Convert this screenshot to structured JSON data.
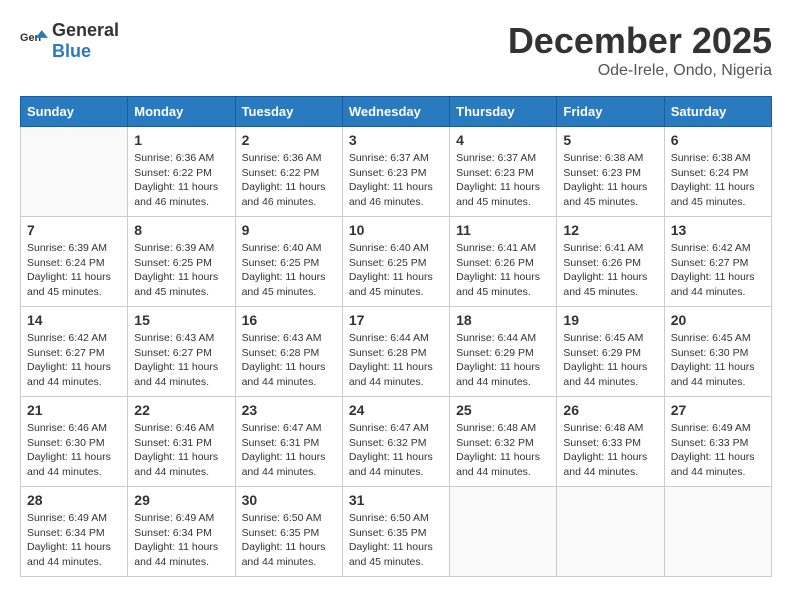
{
  "logo": {
    "general": "General",
    "blue": "Blue"
  },
  "title": {
    "month_year": "December 2025",
    "location": "Ode-Irele, Ondo, Nigeria"
  },
  "headers": [
    "Sunday",
    "Monday",
    "Tuesday",
    "Wednesday",
    "Thursday",
    "Friday",
    "Saturday"
  ],
  "weeks": [
    [
      {
        "day": "",
        "info": ""
      },
      {
        "day": "1",
        "info": "Sunrise: 6:36 AM\nSunset: 6:22 PM\nDaylight: 11 hours and 46 minutes."
      },
      {
        "day": "2",
        "info": "Sunrise: 6:36 AM\nSunset: 6:22 PM\nDaylight: 11 hours and 46 minutes."
      },
      {
        "day": "3",
        "info": "Sunrise: 6:37 AM\nSunset: 6:23 PM\nDaylight: 11 hours and 46 minutes."
      },
      {
        "day": "4",
        "info": "Sunrise: 6:37 AM\nSunset: 6:23 PM\nDaylight: 11 hours and 45 minutes."
      },
      {
        "day": "5",
        "info": "Sunrise: 6:38 AM\nSunset: 6:23 PM\nDaylight: 11 hours and 45 minutes."
      },
      {
        "day": "6",
        "info": "Sunrise: 6:38 AM\nSunset: 6:24 PM\nDaylight: 11 hours and 45 minutes."
      }
    ],
    [
      {
        "day": "7",
        "info": "Sunrise: 6:39 AM\nSunset: 6:24 PM\nDaylight: 11 hours and 45 minutes."
      },
      {
        "day": "8",
        "info": "Sunrise: 6:39 AM\nSunset: 6:25 PM\nDaylight: 11 hours and 45 minutes."
      },
      {
        "day": "9",
        "info": "Sunrise: 6:40 AM\nSunset: 6:25 PM\nDaylight: 11 hours and 45 minutes."
      },
      {
        "day": "10",
        "info": "Sunrise: 6:40 AM\nSunset: 6:25 PM\nDaylight: 11 hours and 45 minutes."
      },
      {
        "day": "11",
        "info": "Sunrise: 6:41 AM\nSunset: 6:26 PM\nDaylight: 11 hours and 45 minutes."
      },
      {
        "day": "12",
        "info": "Sunrise: 6:41 AM\nSunset: 6:26 PM\nDaylight: 11 hours and 45 minutes."
      },
      {
        "day": "13",
        "info": "Sunrise: 6:42 AM\nSunset: 6:27 PM\nDaylight: 11 hours and 44 minutes."
      }
    ],
    [
      {
        "day": "14",
        "info": "Sunrise: 6:42 AM\nSunset: 6:27 PM\nDaylight: 11 hours and 44 minutes."
      },
      {
        "day": "15",
        "info": "Sunrise: 6:43 AM\nSunset: 6:27 PM\nDaylight: 11 hours and 44 minutes."
      },
      {
        "day": "16",
        "info": "Sunrise: 6:43 AM\nSunset: 6:28 PM\nDaylight: 11 hours and 44 minutes."
      },
      {
        "day": "17",
        "info": "Sunrise: 6:44 AM\nSunset: 6:28 PM\nDaylight: 11 hours and 44 minutes."
      },
      {
        "day": "18",
        "info": "Sunrise: 6:44 AM\nSunset: 6:29 PM\nDaylight: 11 hours and 44 minutes."
      },
      {
        "day": "19",
        "info": "Sunrise: 6:45 AM\nSunset: 6:29 PM\nDaylight: 11 hours and 44 minutes."
      },
      {
        "day": "20",
        "info": "Sunrise: 6:45 AM\nSunset: 6:30 PM\nDaylight: 11 hours and 44 minutes."
      }
    ],
    [
      {
        "day": "21",
        "info": "Sunrise: 6:46 AM\nSunset: 6:30 PM\nDaylight: 11 hours and 44 minutes."
      },
      {
        "day": "22",
        "info": "Sunrise: 6:46 AM\nSunset: 6:31 PM\nDaylight: 11 hours and 44 minutes."
      },
      {
        "day": "23",
        "info": "Sunrise: 6:47 AM\nSunset: 6:31 PM\nDaylight: 11 hours and 44 minutes."
      },
      {
        "day": "24",
        "info": "Sunrise: 6:47 AM\nSunset: 6:32 PM\nDaylight: 11 hours and 44 minutes."
      },
      {
        "day": "25",
        "info": "Sunrise: 6:48 AM\nSunset: 6:32 PM\nDaylight: 11 hours and 44 minutes."
      },
      {
        "day": "26",
        "info": "Sunrise: 6:48 AM\nSunset: 6:33 PM\nDaylight: 11 hours and 44 minutes."
      },
      {
        "day": "27",
        "info": "Sunrise: 6:49 AM\nSunset: 6:33 PM\nDaylight: 11 hours and 44 minutes."
      }
    ],
    [
      {
        "day": "28",
        "info": "Sunrise: 6:49 AM\nSunset: 6:34 PM\nDaylight: 11 hours and 44 minutes."
      },
      {
        "day": "29",
        "info": "Sunrise: 6:49 AM\nSunset: 6:34 PM\nDaylight: 11 hours and 44 minutes."
      },
      {
        "day": "30",
        "info": "Sunrise: 6:50 AM\nSunset: 6:35 PM\nDaylight: 11 hours and 44 minutes."
      },
      {
        "day": "31",
        "info": "Sunrise: 6:50 AM\nSunset: 6:35 PM\nDaylight: 11 hours and 45 minutes."
      },
      {
        "day": "",
        "info": ""
      },
      {
        "day": "",
        "info": ""
      },
      {
        "day": "",
        "info": ""
      }
    ]
  ]
}
